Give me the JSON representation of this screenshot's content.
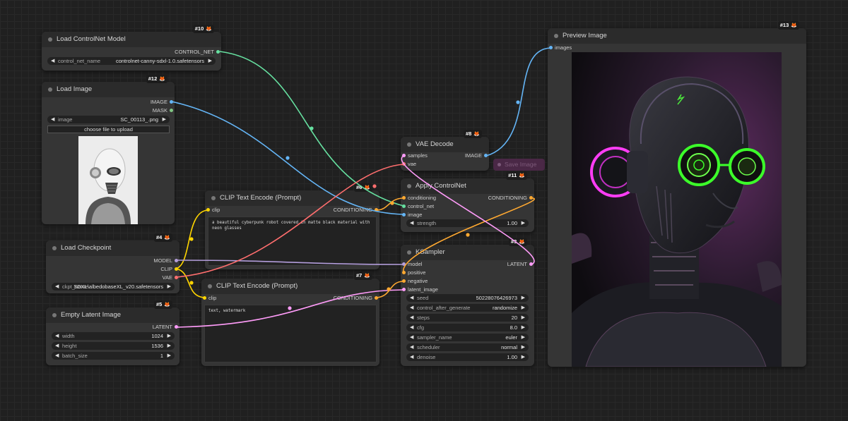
{
  "save_image_ghost": "Save Image",
  "nodes": {
    "controlnet_loader": {
      "title": "Load ControlNet Model",
      "badge": "#10",
      "output": "CONTROL_NET",
      "widget": {
        "label": "control_net_name",
        "value": "controlnet-canny-sdxl-1.0.safetensors"
      }
    },
    "load_image": {
      "title": "Load Image",
      "badge": "#12",
      "outputs": [
        "IMAGE",
        "MASK"
      ],
      "widget": {
        "label": "image",
        "value": "SC_00113_.png"
      },
      "upload_button": "choose file to upload"
    },
    "load_checkpoint": {
      "title": "Load Checkpoint",
      "badge": "#4",
      "outputs": [
        "MODEL",
        "CLIP",
        "VAE"
      ],
      "widget": {
        "label": "ckpt_name",
        "value": "SDXL\\albedobaseXL_v20.safetensors"
      }
    },
    "empty_latent": {
      "title": "Empty Latent Image",
      "badge": "#5",
      "output": "LATENT",
      "widgets": [
        {
          "label": "width",
          "value": "1024"
        },
        {
          "label": "height",
          "value": "1536"
        },
        {
          "label": "batch_size",
          "value": "1"
        }
      ]
    },
    "clip_positive": {
      "title": "CLIP Text Encode (Prompt)",
      "badge": "#6",
      "input": "clip",
      "output": "CONDITIONING",
      "text": "a beautiful cyberpunk robot covered in matte black material with neon glasses"
    },
    "clip_negative": {
      "title": "CLIP Text Encode (Prompt)",
      "badge": "#7",
      "input": "clip",
      "output": "CONDITIONING",
      "text": "text, watermark"
    },
    "vae_decode": {
      "title": "VAE Decode",
      "badge": "#8",
      "inputs": [
        "samples",
        "vae"
      ],
      "output": "IMAGE"
    },
    "apply_controlnet": {
      "title": "Apply ControlNet",
      "badge": "#11",
      "inputs": [
        "conditioning",
        "control_net",
        "image"
      ],
      "output": "CONDITIONING",
      "widget": {
        "label": "strength",
        "value": "1.00"
      }
    },
    "ksampler": {
      "title": "KSampler",
      "badge": "#3",
      "inputs": [
        "model",
        "positive",
        "negative",
        "latent_image"
      ],
      "output": "LATENT",
      "widgets": [
        {
          "label": "seed",
          "value": "50228076426973"
        },
        {
          "label": "control_after_generate",
          "value": "randomize"
        },
        {
          "label": "steps",
          "value": "20"
        },
        {
          "label": "cfg",
          "value": "8.0"
        },
        {
          "label": "sampler_name",
          "value": "euler"
        },
        {
          "label": "scheduler",
          "value": "normal"
        },
        {
          "label": "denoise",
          "value": "1.00"
        }
      ]
    },
    "preview_image": {
      "title": "Preview Image",
      "badge": "#13",
      "input": "images"
    }
  },
  "colors": {
    "model": "#b39ddb",
    "clip": "#ffd500",
    "vae": "#ff6e6e",
    "conditioning": "#ffa931",
    "control_net": "#66e0a0",
    "image": "#64b5f6",
    "mask": "#81c784",
    "latent": "#ff9cf9"
  }
}
